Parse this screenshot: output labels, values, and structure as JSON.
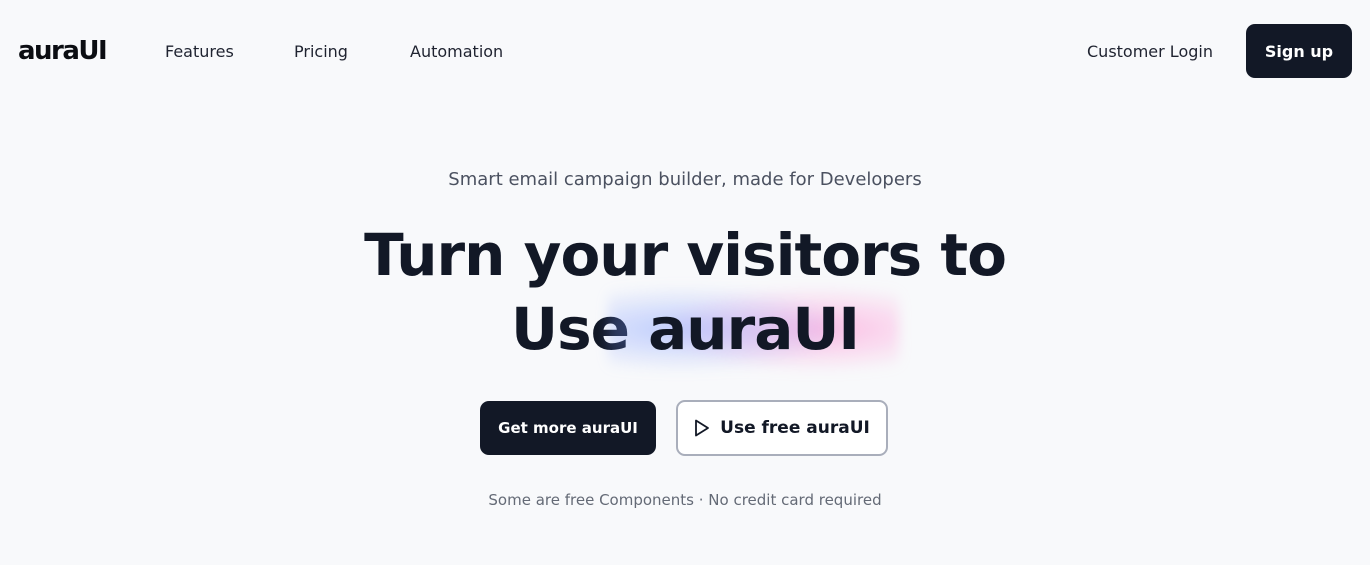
{
  "nav": {
    "logo": "auraUI",
    "links": [
      "Features",
      "Pricing",
      "Automation"
    ],
    "login": "Customer Login",
    "signup": "Sign up"
  },
  "hero": {
    "tagline": "Smart email campaign builder, made for Developers",
    "headline_line1": "Turn your visitors to",
    "headline_line2_prefix": "Use",
    "headline_line2_highlight": "auraUI",
    "primary_button": "Get more auraUI",
    "secondary_button": "Use free auraUI",
    "secondary_icon": "play-icon",
    "note": "Some are free Components · No credit card required"
  },
  "colors": {
    "background": "#f8f9fb",
    "dark": "#121826",
    "muted_text": "#4b5160",
    "glow_blue": "#7896ff",
    "glow_pink": "#ff8cd2"
  }
}
